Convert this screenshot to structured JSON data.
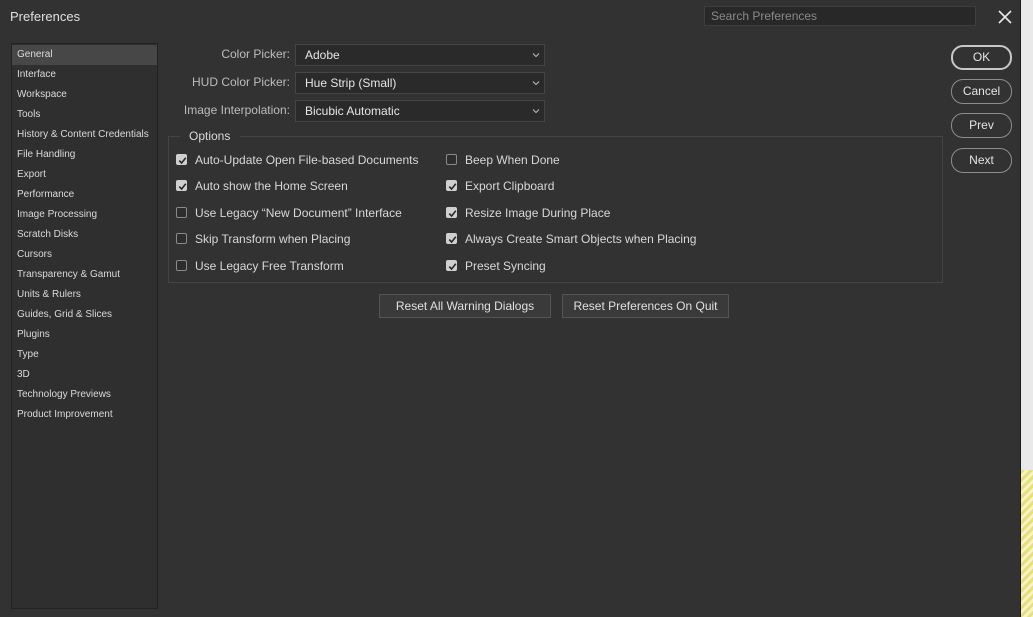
{
  "window": {
    "title": "Preferences"
  },
  "search": {
    "placeholder": "Search Preferences"
  },
  "icons": {
    "close": "close-icon",
    "chevron": "chevron-down-icon",
    "check": "checkmark-icon"
  },
  "sidebar": {
    "selected": "General",
    "items": [
      "General",
      "Interface",
      "Workspace",
      "Tools",
      "History & Content Credentials",
      "File Handling",
      "Export",
      "Performance",
      "Image Processing",
      "Scratch Disks",
      "Cursors",
      "Transparency & Gamut",
      "Units & Rulers",
      "Guides, Grid & Slices",
      "Plugins",
      "Type",
      "3D",
      "Technology Previews",
      "Product Improvement"
    ]
  },
  "general": {
    "color_picker": {
      "label": "Color Picker:",
      "value": "Adobe"
    },
    "hud_color_picker": {
      "label": "HUD Color Picker:",
      "value": "Hue Strip (Small)"
    },
    "image_interpolation": {
      "label": "Image Interpolation:",
      "value": "Bicubic Automatic"
    }
  },
  "options": {
    "title": "Options",
    "left": [
      {
        "label": "Auto-Update Open File-based Documents",
        "checked": true
      },
      {
        "label": "Auto show the Home Screen",
        "checked": true
      },
      {
        "label": "Use Legacy “New Document” Interface",
        "checked": false
      },
      {
        "label": "Skip Transform when Placing",
        "checked": false
      },
      {
        "label": "Use Legacy Free Transform",
        "checked": false
      }
    ],
    "right": [
      {
        "label": "Beep When Done",
        "checked": false
      },
      {
        "label": "Export Clipboard",
        "checked": true
      },
      {
        "label": "Resize Image During Place",
        "checked": true
      },
      {
        "label": "Always Create Smart Objects when Placing",
        "checked": true
      },
      {
        "label": "Preset Syncing",
        "checked": true
      }
    ]
  },
  "reset": {
    "warnings": "Reset All Warning Dialogs",
    "prefs_on_quit": "Reset Preferences On Quit"
  },
  "actions": {
    "ok": "OK",
    "cancel": "Cancel",
    "prev": "Prev",
    "next": "Next"
  },
  "colors": {
    "dialog_bg": "#323232",
    "sidebar_selected": "#474747",
    "text": "#d6d6d6",
    "checkbox_on": "#d0d0d0"
  }
}
